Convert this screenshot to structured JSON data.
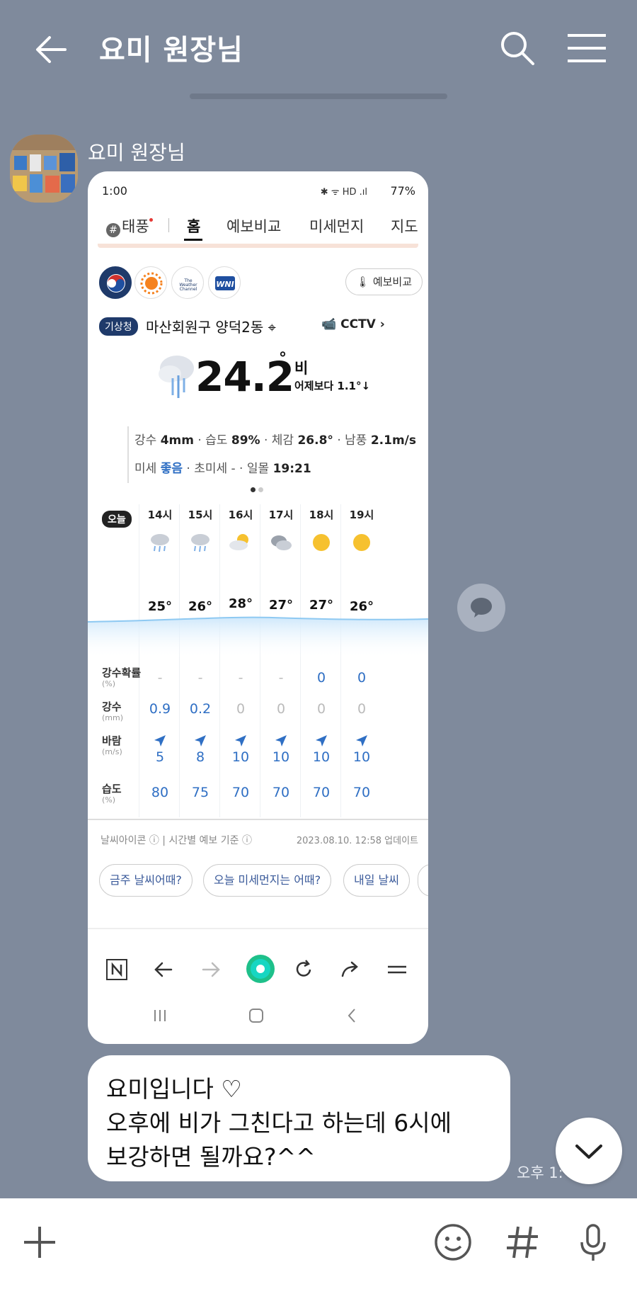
{
  "header": {
    "title": "요미 원장님",
    "back_icon": "back-arrow-icon",
    "search_icon": "search-icon",
    "menu_icon": "hamburger-menu-icon"
  },
  "message": {
    "sender": "요미 원장님",
    "time": "오후 1:",
    "text_lines": [
      "요미입니다 ♡",
      "오후에 비가  그친다고  하는데 6시에",
      "보강하면 될까요?^^"
    ]
  },
  "screenshot": {
    "status": {
      "time": "1:00",
      "battery": "77%",
      "icons": "✱ ᯤ HD .ıl"
    },
    "tabs": [
      "태풍",
      "홈",
      "예보비교",
      "미세먼지",
      "지도"
    ],
    "compare_button": "예보비교",
    "source_badge": "기상청",
    "location": "마산회원구 양덕2동",
    "cctv": "CCTV",
    "current": {
      "temp": "24.2",
      "deg": "°",
      "condition": "비",
      "vs_yesterday": "어제보다 1.1°↓"
    },
    "details": {
      "rain_label": "강수",
      "rain": "4mm",
      "humidity_label": "습도",
      "humidity": "89%",
      "feels_label": "체감",
      "feels": "26.8°",
      "wind_label": "남풍",
      "wind": "2.1m/s",
      "dust_label": "미세",
      "dust": "좋음",
      "ultrafine_label": "초미세",
      "ultrafine": "-",
      "sunset_label": "일몰",
      "sunset": "19:21"
    },
    "today_label": "오늘",
    "hours": [
      "14시",
      "15시",
      "16시",
      "17시",
      "18시",
      "19시"
    ],
    "hour_icons": [
      "rain-cloud-icon",
      "rain-cloud-icon",
      "sun-cloud-icon",
      "cloud-icon",
      "sun-icon",
      "sun-icon"
    ],
    "temps": [
      "25°",
      "26°",
      "28°",
      "27°",
      "27°",
      "26°"
    ],
    "row_labels": {
      "prob": "강수확률",
      "prob_unit": "(%)",
      "precip": "강수",
      "precip_unit": "(mm)",
      "wind": "바람",
      "wind_unit": "(m/s)",
      "humid": "습도",
      "humid_unit": "(%)"
    },
    "prob": [
      "-",
      "-",
      "-",
      "-",
      "0",
      "0"
    ],
    "precip": [
      "0.9",
      "0.2",
      "0",
      "0",
      "0",
      "0"
    ],
    "wind": [
      "5",
      "8",
      "10",
      "10",
      "10",
      "10"
    ],
    "humid": [
      "80",
      "75",
      "70",
      "70",
      "70",
      "70"
    ],
    "footnote": "날씨아이콘 ⓘ | 시간별 예보 기준 ⓘ",
    "updated": "2023.08.10. 12:58 업데이트",
    "chips": [
      "금주 날씨어때?",
      "오늘 미세먼지는 어때?",
      "내일 날씨"
    ]
  },
  "colors": {
    "chat_bg": "#7f8a9c",
    "accent_blue": "#2f6fc4",
    "kma_navy": "#1f3a6a"
  }
}
